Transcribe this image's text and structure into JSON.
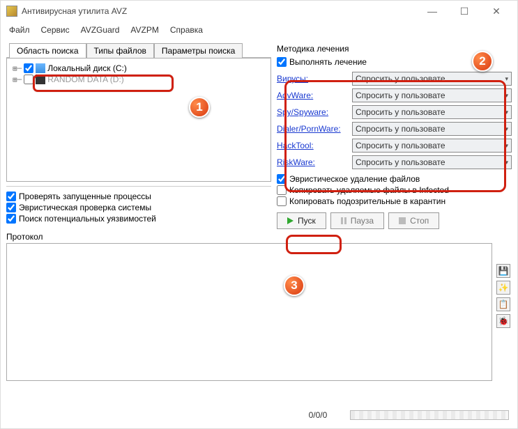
{
  "window": {
    "title": "Антивирусная утилита AVZ"
  },
  "menu": [
    "Файл",
    "Сервис",
    "AVZGuard",
    "AVZPM",
    "Справка"
  ],
  "tabs_left": [
    {
      "label": "Область поиска",
      "active": true
    },
    {
      "label": "Типы файлов",
      "active": false
    },
    {
      "label": "Параметры поиска",
      "active": false
    }
  ],
  "tree": {
    "item1": {
      "label": "Локальный диск (C:)",
      "checked": true
    },
    "item2": {
      "label": "RANDOM DATA (D:)",
      "checked": false
    }
  },
  "left_checks": {
    "c1": "Проверять запущенные процессы",
    "c2": "Эвристическая проверка системы",
    "c3": "Поиск потенциальных уязвимостей"
  },
  "treatment": {
    "section": "Методика лечения",
    "perform": "Выполнять лечение",
    "option": "Спросить у пользовате",
    "rows": [
      {
        "name": "Вирусы:"
      },
      {
        "name": "AdvWare:"
      },
      {
        "name": "Spy/Spyware:"
      },
      {
        "name": "Dialer/PornWare:"
      },
      {
        "name": "HackTool:"
      },
      {
        "name": "RiskWare:"
      }
    ],
    "extra": {
      "e1": "Эвристическое удаление файлов",
      "e2": "Копировать удаляемые файлы в Infected",
      "e3": "Копировать подозрительные в карантин"
    }
  },
  "buttons": {
    "start": "Пуск",
    "pause": "Пауза",
    "stop": "Стоп"
  },
  "protocol_label": "Протокол",
  "status": {
    "counts": "0/0/0"
  },
  "callouts": {
    "c1": "1",
    "c2": "2",
    "c3": "3"
  },
  "icons": {
    "save": "💾",
    "sparkle": "✨",
    "copy": "📋",
    "bug": "🐞"
  }
}
